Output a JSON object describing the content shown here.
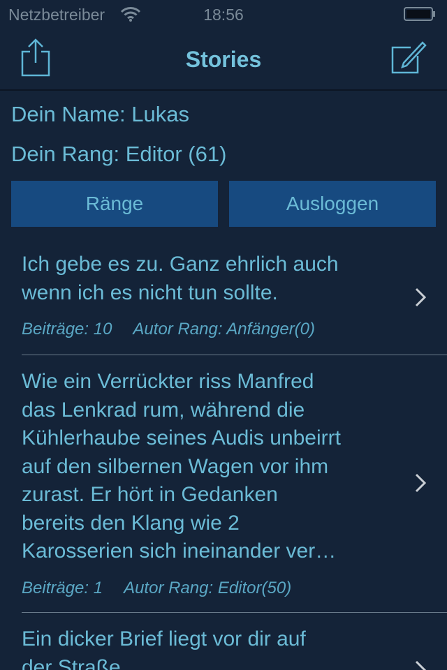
{
  "status_bar": {
    "carrier": "Netzbetreiber",
    "time": "18:56"
  },
  "navbar": {
    "title": "Stories",
    "left_icon": "share-icon",
    "right_icon": "compose-icon"
  },
  "profile": {
    "name_line": "Dein Name: Lukas",
    "rank_line": "Dein Rang: Editor (61)"
  },
  "buttons": {
    "raenge": "Ränge",
    "logout": "Ausloggen"
  },
  "stories": [
    {
      "text": "Ich gebe es zu. Ganz ehrlich auch\nwenn ich es nicht tun sollte.",
      "posts": "Beiträge: 10",
      "author_rank": "Autor Rang: Anfänger(0)"
    },
    {
      "text": "Wie ein Verrückter riss Manfred\ndas Lenkrad rum, während die\nKühlerhaube seines Audis unbeirrt\nauf den silbernen Wagen vor ihm\nzurast. Er hört in Gedanken\nbereits den Klang wie 2\nKarosserien sich ineinander ver…",
      "posts": "Beiträge: 1",
      "author_rank": "Autor Rang: Editor(50)"
    },
    {
      "text": "Ein dicker Brief liegt vor dir auf\nder Straße.",
      "posts": "",
      "author_rank": ""
    }
  ],
  "colors": {
    "background": "#142338",
    "text": "#6bbbd6",
    "button": "#174a80"
  }
}
